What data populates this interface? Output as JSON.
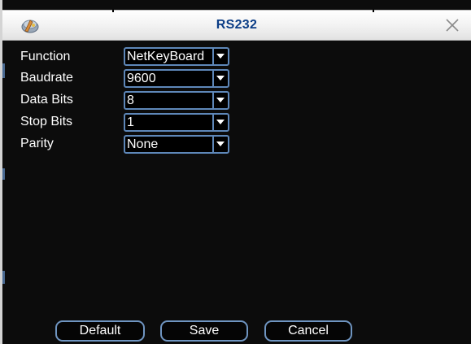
{
  "window": {
    "title": "RS232",
    "icon": "settings-tool-icon",
    "close_icon": "close-icon"
  },
  "fields": [
    {
      "label": "Function",
      "value": "NetKeyBoard"
    },
    {
      "label": "Baudrate",
      "value": "9600"
    },
    {
      "label": "Data Bits",
      "value": "8"
    },
    {
      "label": "Stop Bits",
      "value": "1"
    },
    {
      "label": "Parity",
      "value": "None"
    }
  ],
  "buttons": {
    "default_label": "Default",
    "save_label": "Save",
    "cancel_label": "Cancel"
  },
  "colors": {
    "title_text": "#0b3d86",
    "accent_border": "#5e87b8",
    "background": "#0c0c0c",
    "text": "#ffffff"
  }
}
